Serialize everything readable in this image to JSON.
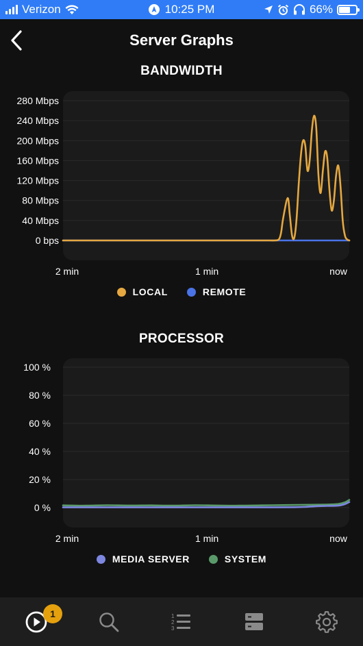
{
  "status_bar": {
    "carrier": "Verizon",
    "time": "10:25 PM",
    "battery": "66%",
    "battery_level": 0.66,
    "icons": [
      "signal-bars-icon",
      "wifi-icon",
      "navigation-badge-icon",
      "location-arrow-icon",
      "alarm-icon",
      "headphones-icon",
      "battery-icon"
    ]
  },
  "header": {
    "title": "Server Graphs",
    "back_icon": "chevron-left-icon"
  },
  "bandwidth": {
    "title": "BANDWIDTH",
    "legend": [
      {
        "label": "LOCAL",
        "color": "#e5a840"
      },
      {
        "label": "REMOTE",
        "color": "#4a73e8"
      }
    ]
  },
  "processor": {
    "title": "PROCESSOR",
    "legend": [
      {
        "label": "MEDIA SERVER",
        "color": "#7d87e0"
      },
      {
        "label": "SYSTEM",
        "color": "#5a9a6a"
      }
    ]
  },
  "tab_bar": {
    "badge_count": "1",
    "tabs": [
      "play-circle-icon",
      "search-icon",
      "queue-list-icon",
      "server-icon",
      "gear-icon"
    ],
    "accent": "#e5a00d"
  },
  "chart_data": [
    {
      "type": "line",
      "title": "BANDWIDTH",
      "ylim": [
        0,
        280
      ],
      "yticks": [
        0,
        40,
        80,
        120,
        160,
        200,
        240,
        280
      ],
      "ytick_labels": [
        "0 bps",
        "40 Mbps",
        "80 Mbps",
        "120 Mbps",
        "160 Mbps",
        "200 Mbps",
        "240 Mbps",
        "280 Mbps"
      ],
      "xlim": [
        -130,
        0
      ],
      "xticks": [
        -120,
        -60,
        0
      ],
      "xtick_labels": [
        "2 min",
        "1 min",
        "now"
      ],
      "grid": true,
      "legend_position": "bottom",
      "series": [
        {
          "name": "LOCAL",
          "color": "#e5a840",
          "x": [
            -130,
            -120,
            -100,
            -80,
            -60,
            -40,
            -36,
            -34,
            -32,
            -31,
            -30,
            -28,
            -27,
            -26,
            -25,
            -24,
            -23,
            -22,
            -21,
            -20,
            -19,
            -18,
            -17,
            -16,
            -15,
            -14,
            -13,
            -12,
            -11,
            -10,
            -9,
            -8,
            -7,
            -6,
            -5,
            -4,
            -3,
            -2,
            -1,
            0
          ],
          "y": [
            0,
            0,
            0,
            0,
            0,
            0,
            0,
            0,
            2,
            15,
            45,
            85,
            50,
            10,
            5,
            40,
            110,
            170,
            200,
            190,
            140,
            160,
            220,
            250,
            225,
            130,
            95,
            140,
            178,
            165,
            100,
            60,
            80,
            130,
            150,
            110,
            40,
            10,
            2,
            0
          ]
        },
        {
          "name": "REMOTE",
          "color": "#4a73e8",
          "x": [
            -130,
            0
          ],
          "y": [
            0,
            0
          ]
        }
      ]
    },
    {
      "type": "line",
      "title": "PROCESSOR",
      "ylim": [
        0,
        100
      ],
      "yticks": [
        0,
        20,
        40,
        60,
        80,
        100
      ],
      "ytick_labels": [
        "0 %",
        "20 %",
        "40 %",
        "60 %",
        "80 %",
        "100 %"
      ],
      "xlim": [
        -130,
        0
      ],
      "xticks": [
        -120,
        -60,
        0
      ],
      "xtick_labels": [
        "2 min",
        "1 min",
        "now"
      ],
      "grid": true,
      "legend_position": "bottom",
      "series": [
        {
          "name": "MEDIA SERVER",
          "color": "#7d87e0",
          "x": [
            -130,
            -110,
            -90,
            -70,
            -50,
            -35,
            -25,
            -20,
            -15,
            -10,
            -5,
            -2,
            0
          ],
          "y": [
            0.2,
            0.2,
            0.2,
            0.2,
            0.2,
            0.2,
            0.3,
            0.5,
            1.0,
            1.2,
            1.4,
            2.5,
            4.0
          ]
        },
        {
          "name": "SYSTEM",
          "color": "#5a9a6a",
          "x": [
            -130,
            -120,
            -110,
            -100,
            -90,
            -80,
            -70,
            -60,
            -50,
            -40,
            -30,
            -20,
            -10,
            -5,
            -2,
            0
          ],
          "y": [
            1.6,
            1.4,
            1.7,
            1.5,
            1.6,
            1.4,
            1.7,
            1.5,
            1.4,
            1.6,
            1.8,
            2.0,
            2.2,
            2.6,
            3.8,
            5.5
          ]
        }
      ]
    }
  ]
}
